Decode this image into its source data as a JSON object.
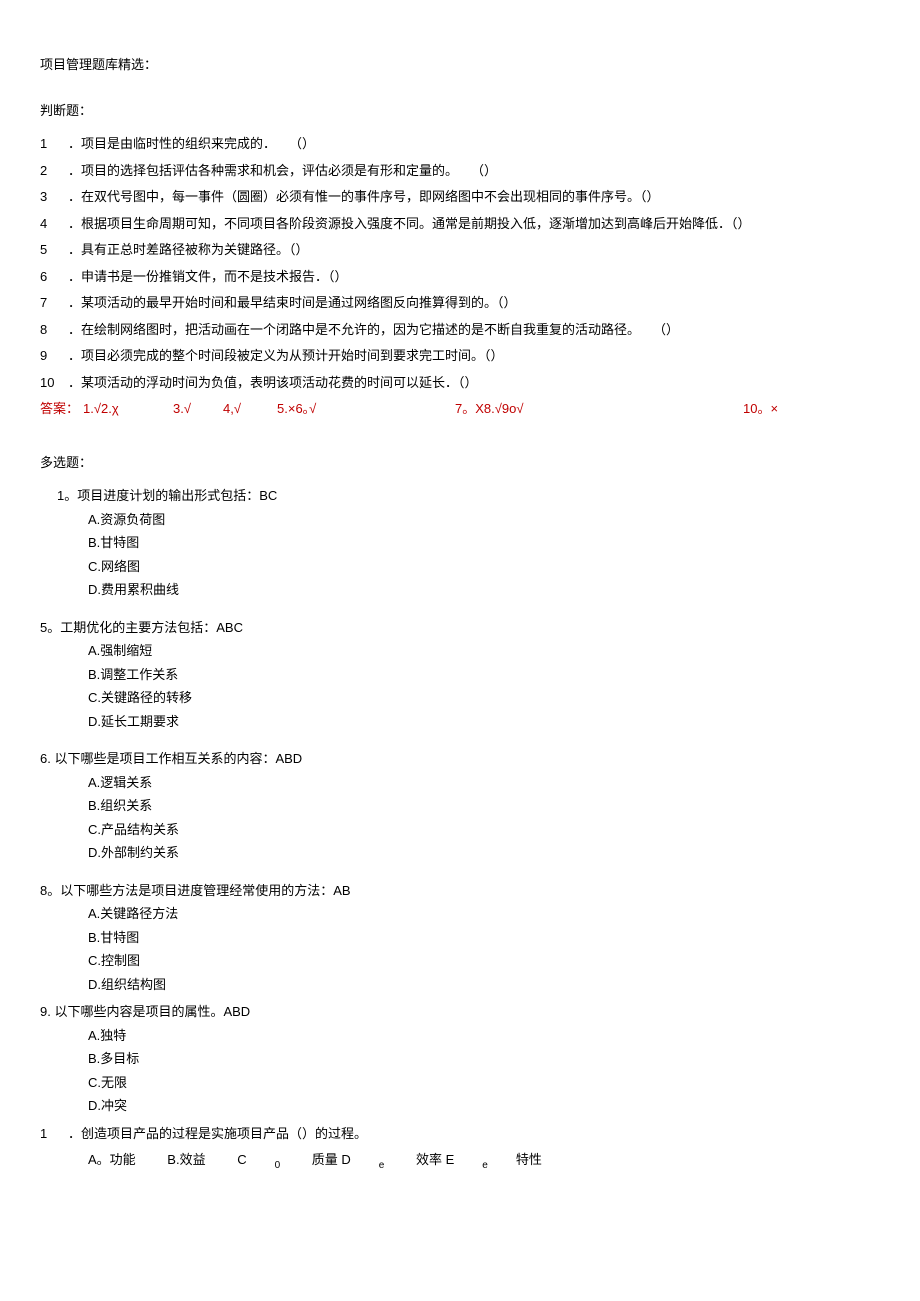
{
  "title": "项目管理题库精选：",
  "sections": {
    "truefalse": {
      "header": "判断题：",
      "items": [
        {
          "num": "1",
          "text": "．项目是由临时性的组织来完成的．　　（）"
        },
        {
          "num": "2",
          "text": "．项目的选择包括评估各种需求和机会，评估必须是有形和定量的。　　（）"
        },
        {
          "num": "3",
          "text": "．在双代号图中，每一事件（圆圈）必须有惟一的事件序号，即网络图中不会出现相同的事件序号。（）"
        },
        {
          "num": "4",
          "text": "．根据项目生命周期可知，不同项目各阶段资源投入强度不同。通常是前期投入低，逐渐增加达到高峰后开始降低．（）"
        },
        {
          "num": "5",
          "text": "．具有正总时差路径被称为关键路径。（）"
        },
        {
          "num": "6",
          "text": "．申请书是一份推销文件，而不是技术报告．（）"
        },
        {
          "num": "7",
          "text": "．某项活动的最早开始时间和最早结束时间是通过网络图反向推算得到的。（）"
        },
        {
          "num": "8",
          "text": "．在绘制网络图时，把活动画在一个闭路中是不允许的，因为它描述的是不断自我重复的活动路径。　　（）"
        },
        {
          "num": "9",
          "text": "．项目必须完成的整个时间段被定义为从预计开始时间到要求完工时间。（）"
        },
        {
          "num": "10",
          "text": "．某项活动的浮动时间为负值，表明该项活动花费的时间可以延长．（）"
        }
      ],
      "answer_label": "答案：",
      "answers": {
        "a1": "1.√2.χ",
        "a3": "3.√",
        "a4": "4,√",
        "a5": "5.×6｡√",
        "a6": "",
        "a7": "7。X8.√9o√",
        "a8": "",
        "a9": "",
        "a10": "10。×"
      }
    },
    "multichoice": {
      "header": "多选题：",
      "questions": [
        {
          "num": "1。",
          "stem": "项目进度计划的输出形式包括：BC",
          "indent": true,
          "opts": [
            "A.资源负荷图",
            "B.甘特图",
            "C.网络图",
            "D.费用累积曲线"
          ]
        },
        {
          "num": "5。",
          "stem": "工期优化的主要方法包括：ABC",
          "indent": false,
          "opts": [
            "A.强制缩短",
            "B.调整工作关系",
            "C.关键路径的转移",
            "D.延长工期要求"
          ]
        },
        {
          "num": "6. ",
          "stem": "以下哪些是项目工作相互关系的内容：ABD",
          "indent": false,
          "opts": [
            "A.逻辑关系",
            "B.组织关系",
            "C.产品结构关系",
            "D.外部制约关系"
          ]
        },
        {
          "num": "8。",
          "stem": "以下哪些方法是项目进度管理经常使用的方法：AB",
          "indent": false,
          "opts": [
            "A.关键路径方法",
            "B.甘特图",
            "C.控制图",
            "D.组织结构图"
          ]
        },
        {
          "num": "9. ",
          "stem": "以下哪些内容是项目的属性。ABD",
          "indent": false,
          "opts": [
            "A.独特",
            "B.多目标",
            "C.无限",
            "D.冲突"
          ]
        }
      ],
      "final_q": {
        "num": "1",
        "stem": "．创造项目产品的过程是实施项目产品（）的过程。",
        "opts": {
          "a": "A。功能",
          "b": "B.效益",
          "c_pre": "C",
          "c_sub": "0",
          "c_post": " 质量 D",
          "d_sub": "e",
          "d_post": " 效率 E",
          "e_sub": "e",
          "e_post": "特性"
        }
      }
    }
  }
}
